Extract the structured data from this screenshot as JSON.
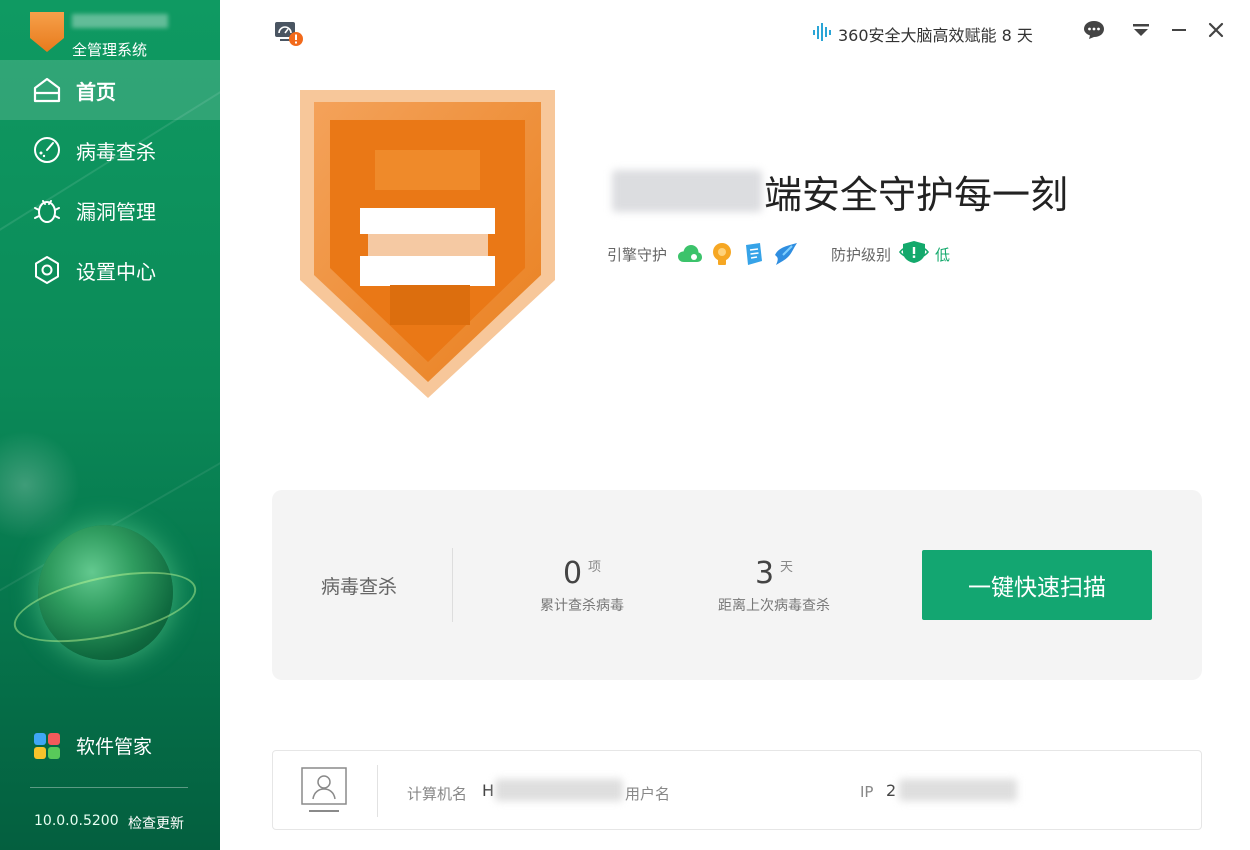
{
  "app": {
    "subtitle": "全管理系统"
  },
  "sidebar": {
    "items": [
      {
        "label": "首页",
        "icon": "home-icon",
        "active": true
      },
      {
        "label": "病毒查杀",
        "icon": "virus-scan-icon"
      },
      {
        "label": "漏洞管理",
        "icon": "bug-icon"
      },
      {
        "label": "设置中心",
        "icon": "settings-icon"
      }
    ],
    "software_manager": "软件管家",
    "version": "10.0.0.5200",
    "check_update": "检查更新"
  },
  "topbar": {
    "brain_text": "360安全大脑高效赋能 8 天",
    "icons": [
      "monitor-alert-icon",
      "chat-icon",
      "menu-dropdown-icon",
      "minimize-icon",
      "close-icon"
    ]
  },
  "hero": {
    "title": "端安全守护每一刻",
    "engine_label": "引擎守护",
    "engine_icons": [
      "cloud-engine-icon",
      "ai-engine-icon",
      "scroll-engine-icon",
      "bird-engine-icon"
    ],
    "level_label": "防护级别",
    "level_value": "低"
  },
  "scan": {
    "title": "病毒查杀",
    "stats": [
      {
        "value": "0",
        "unit": "项",
        "label": "累计查杀病毒"
      },
      {
        "value": "3",
        "unit": "天",
        "label": "距离上次病毒查杀"
      }
    ],
    "button": "一键快速扫描"
  },
  "info": {
    "computer_label": "计算机名",
    "computer_value_prefix": "H",
    "user_label": "用户名",
    "ip_label": "IP",
    "ip_value_prefix": "2"
  },
  "colors": {
    "sidebar_green": "#0b8a58",
    "accent": "#13a671",
    "shield_orange": "#e87a1c"
  }
}
